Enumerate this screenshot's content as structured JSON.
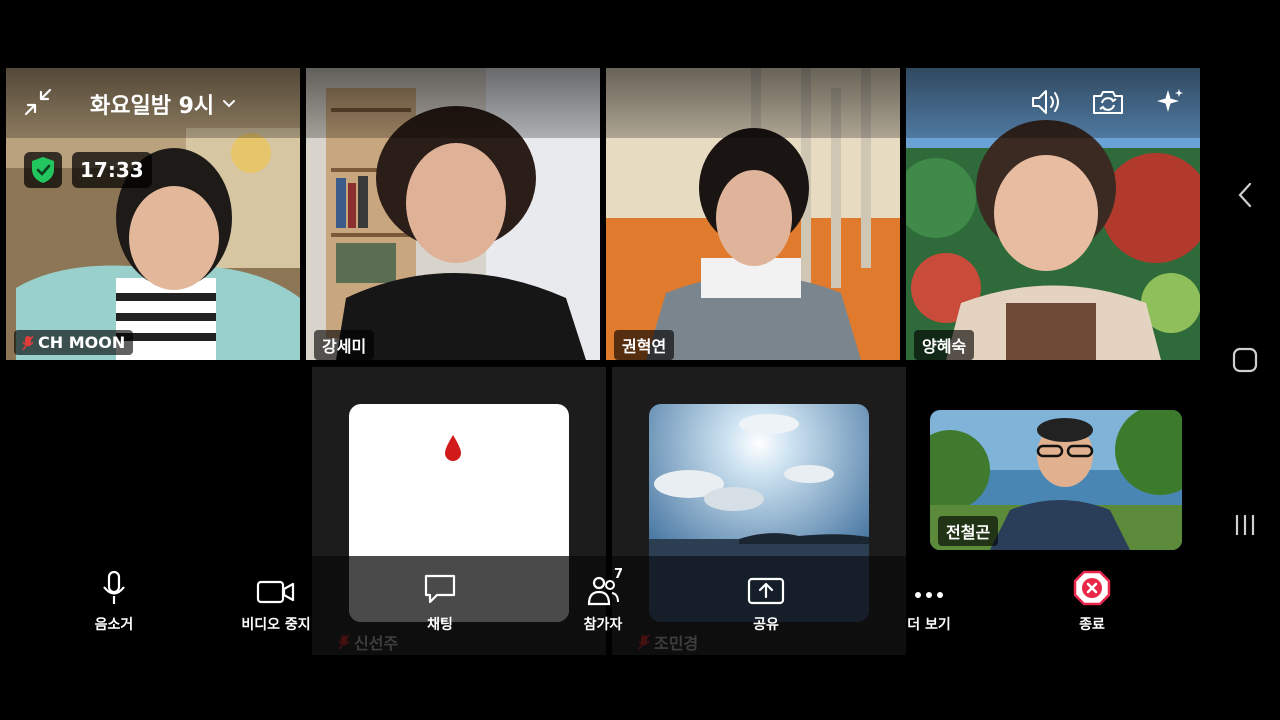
{
  "header": {
    "meeting_title": "화요일밤 9시",
    "timer": "17:33"
  },
  "participants": [
    {
      "name": "CH MOON",
      "muted": true
    },
    {
      "name": "강세미",
      "muted": false
    },
    {
      "name": "권혁연",
      "muted": false
    },
    {
      "name": "양혜숙",
      "muted": false
    },
    {
      "name": "신선주",
      "muted": true
    },
    {
      "name": "조민경",
      "muted": true
    },
    {
      "name": "전철곤",
      "muted": false
    }
  ],
  "toolbar": {
    "mute_label": "음소거",
    "video_label": "비디오 중지",
    "chat_label": "채팅",
    "participants_label": "참가자",
    "participants_count": "7",
    "share_label": "공유",
    "more_label": "더 보기",
    "end_label": "종료"
  },
  "colors": {
    "end_red": "#e8264a",
    "shield_green": "#22c55e"
  }
}
